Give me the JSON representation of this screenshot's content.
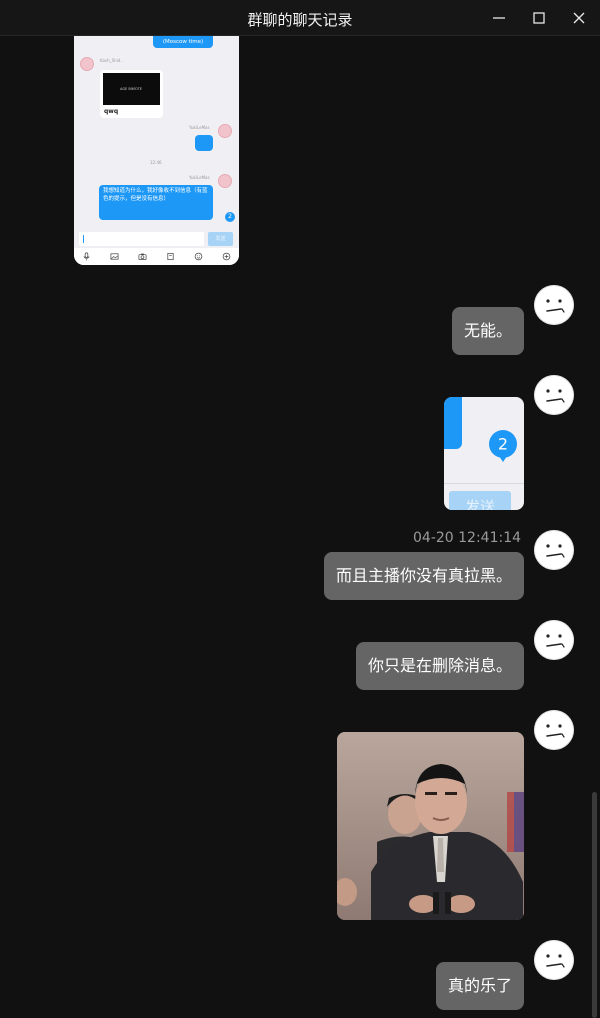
{
  "window": {
    "title": "群聊的聊天记录"
  },
  "embedded_screenshot": {
    "time_note": "(Moscow time)",
    "sender1": "Kash_Shid..",
    "video_label": "AGE BIMOTE",
    "card_caption": "qwq",
    "sender2": "YukiLeMas",
    "time": "12:46",
    "sender3": "YukiLeMas",
    "message": "我想知道为什么，我好像收不到信息（有蓝色的提示，但是没有信息）",
    "badge": "2",
    "send_label": "发送"
  },
  "cropped_screenshot": {
    "badge": "2",
    "send_label": "发送"
  },
  "messages": [
    {
      "text": "无能。"
    },
    {
      "text": "而且主播你没有真拉黑。",
      "timestamp": "04-20 12:41:14"
    },
    {
      "text": "你只是在删除消息。"
    },
    {
      "text": "真的乐了"
    }
  ]
}
